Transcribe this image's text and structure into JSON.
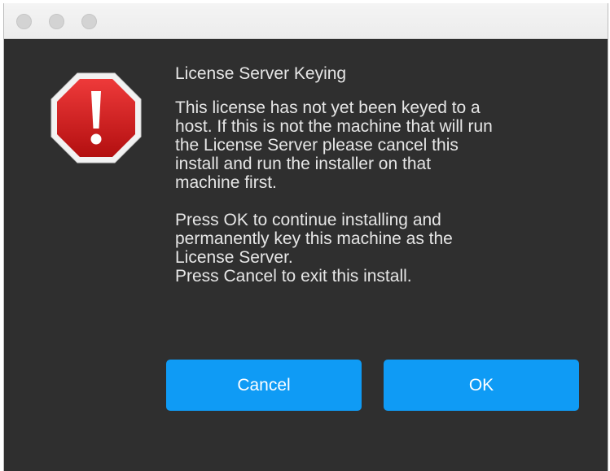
{
  "dialog": {
    "icon": "warning-octagon-icon",
    "title": "License Server Keying",
    "message_paragraphs": [
      "This license has not yet been keyed to a\nhost. If this is not the machine that will run\nthe License Server please cancel this\ninstall and run the installer on that\nmachine first.",
      "Press OK to continue installing and\npermanently key this machine as the\nLicense Server.\nPress Cancel to exit this install."
    ],
    "buttons": {
      "cancel_label": "Cancel",
      "ok_label": "OK"
    }
  },
  "colors": {
    "window_bg": "#2f2f2f",
    "titlebar_bg": "#ececec",
    "button_bg": "#0f9bf5",
    "text": "#e6e6e6",
    "icon_red": "#d3191a"
  }
}
